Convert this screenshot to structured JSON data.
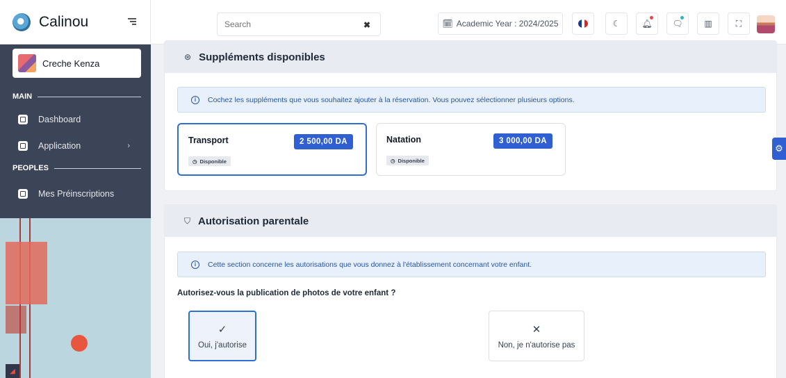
{
  "app": {
    "name": "Calinou"
  },
  "header": {
    "search_placeholder": "Search",
    "academic_year": "Academic Year : 2024/2025"
  },
  "sidebar": {
    "school_name": "Creche Kenza",
    "sections": [
      {
        "title": "MAIN"
      },
      {
        "title": "PEOPLES"
      }
    ],
    "items": [
      {
        "label": "Dashboard"
      },
      {
        "label": "Application"
      },
      {
        "label": "Mes Préinscriptions"
      }
    ]
  },
  "supplements": {
    "title": "Suppléments disponibles",
    "info": "Cochez les suppléments que vous souhaitez ajouter à la réservation. Vous pouvez sélectionner plusieurs options.",
    "options": [
      {
        "name": "Transport",
        "price": "2 500,00 DA",
        "status": "Disponible",
        "selected": true
      },
      {
        "name": "Natation",
        "price": "3 000,00 DA",
        "status": "Disponible",
        "selected": false
      }
    ]
  },
  "authorization": {
    "title": "Autorisation parentale",
    "info": "Cette section concerne les autorisations que vous donnez à l'établissement concernant votre enfant.",
    "question": "Autorisez-vous la publication de photos de votre enfant ?",
    "choices": [
      {
        "label": "Oui, j'autorise",
        "icon": "check-icon",
        "selected": true
      },
      {
        "label": "Non, je n'autorise pas",
        "icon": "x-icon",
        "selected": false
      }
    ]
  },
  "colors": {
    "accent": "#2f5fd0",
    "sidebar": "#3c4457",
    "info_bg": "#e8f0fb"
  }
}
